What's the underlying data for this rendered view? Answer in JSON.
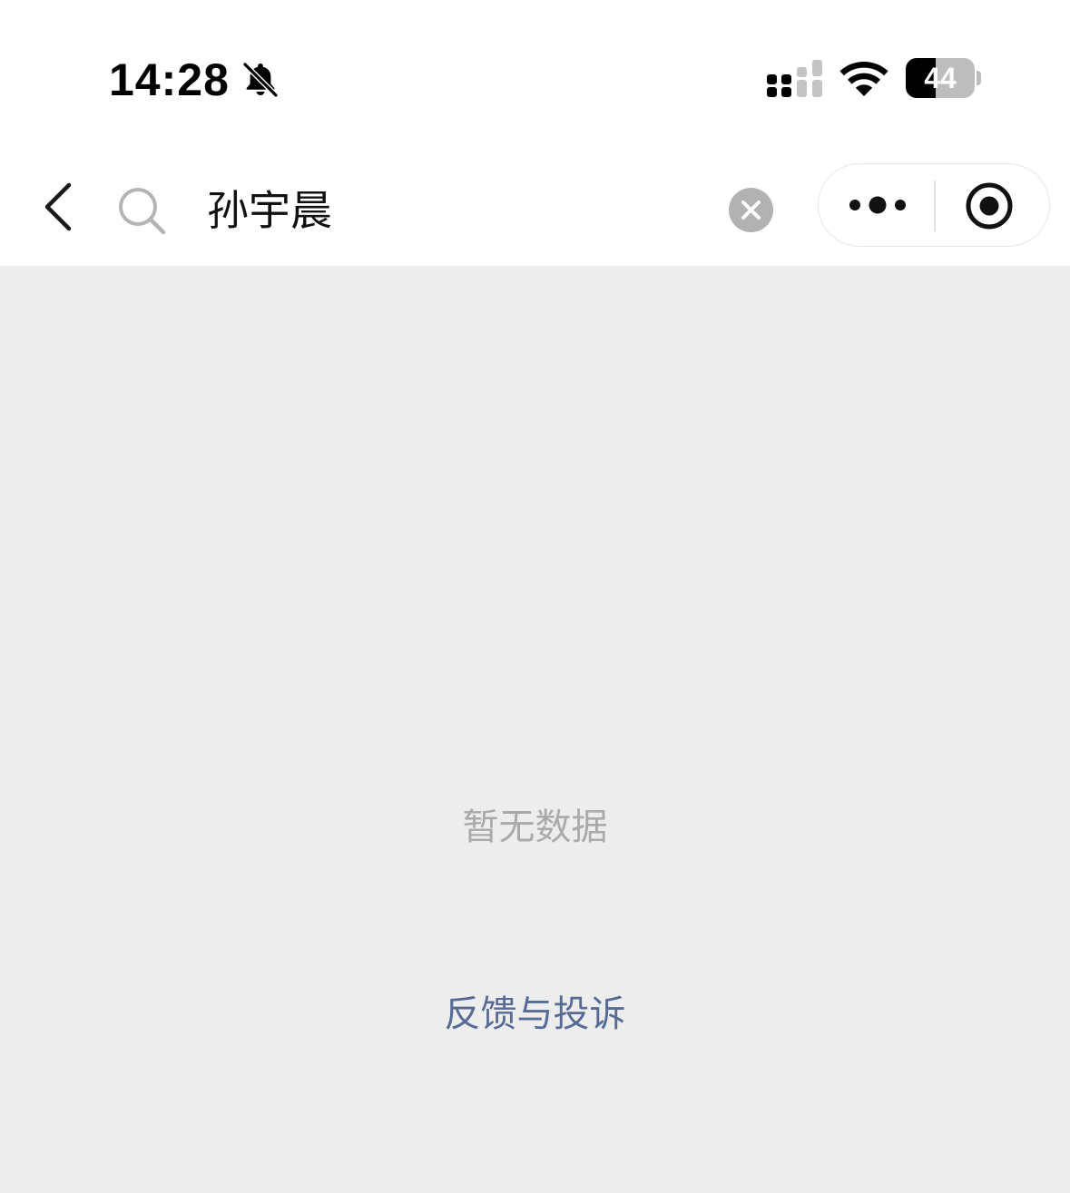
{
  "status_bar": {
    "time": "14:28",
    "battery_level": 44,
    "battery_label": "44",
    "icons": [
      "bell-slash-icon",
      "cellular-signal-icon",
      "wifi-icon",
      "battery-icon"
    ]
  },
  "nav": {
    "search_value": "孙宇晨",
    "icons": [
      "back-chevron-icon",
      "search-icon",
      "clear-icon",
      "more-dots-icon",
      "close-miniprogram-icon"
    ]
  },
  "content": {
    "empty_message": "暂无数据",
    "feedback_link": "反馈与投诉"
  },
  "colors": {
    "background": "#ededed",
    "link": "#576b95",
    "muted_text": "#aaaaaa"
  }
}
